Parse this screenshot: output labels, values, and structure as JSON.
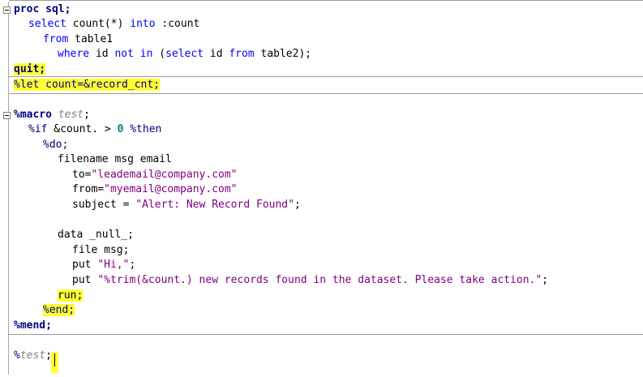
{
  "editor": {
    "lines": {
      "l1": [
        "proc sql",
        ";"
      ],
      "l2": [
        "select",
        " count(*) ",
        "into",
        " :count"
      ],
      "l3": [
        "from",
        " table1"
      ],
      "l4": [
        "where",
        " id ",
        "not",
        " ",
        "in",
        " (",
        "select",
        " id ",
        "from",
        " table2);"
      ],
      "l5": [
        "quit;"
      ],
      "l6": [
        "%let count=&record_cnt;"
      ],
      "l7": [
        "%macro",
        " ",
        "test",
        ";"
      ],
      "l8": [
        "%if",
        " &count. > ",
        "0",
        " ",
        "%then"
      ],
      "l9": [
        "%do;"
      ],
      "l10": [
        "filename msg email"
      ],
      "l11": [
        "to=",
        "\"leademail@company.com\""
      ],
      "l12": [
        "from=",
        "\"myemail@company.com\""
      ],
      "l13": [
        "subject = ",
        "\"Alert: New Record Found\"",
        ";"
      ],
      "l14": [
        "data _null_;"
      ],
      "l15": [
        "file msg;"
      ],
      "l16": [
        "put ",
        "\"Hi,\"",
        ";"
      ],
      "l17": [
        "put ",
        "\"%trim(&count.) new records found in the dataset. Please take action.\"",
        ";"
      ],
      "l18": [
        "run;"
      ],
      "l19": [
        "%end;"
      ],
      "l20": [
        "%mend;"
      ],
      "l21": [
        "%",
        "test",
        ";"
      ]
    }
  },
  "colors": {
    "keyword": "#000080",
    "statement": "#0000ff",
    "string": "#800080",
    "number": "#008080",
    "macro_name": "#808080",
    "highlight": "#ffff33"
  }
}
